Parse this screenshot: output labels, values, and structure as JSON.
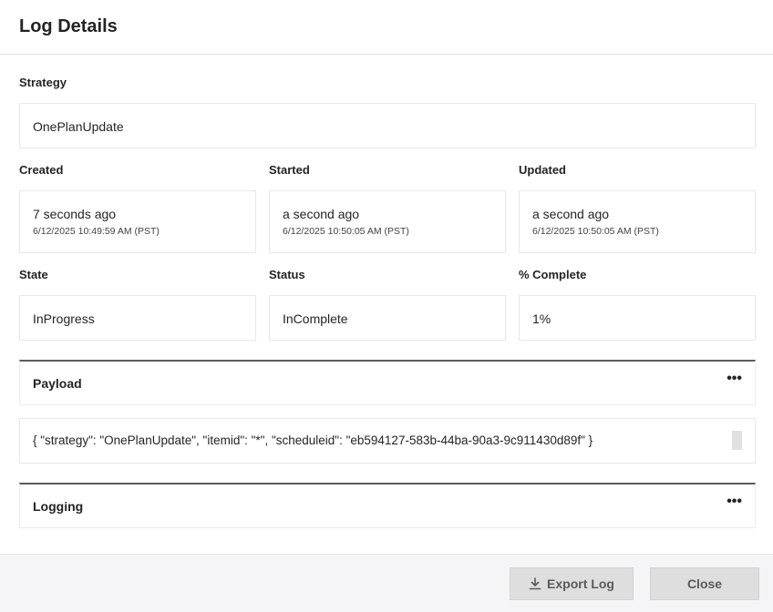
{
  "dialog": {
    "title": "Log Details"
  },
  "fields": {
    "strategy": {
      "label": "Strategy",
      "value": "OnePlanUpdate"
    },
    "created": {
      "label": "Created",
      "relative": "7 seconds ago",
      "timestamp": "6/12/2025 10:49:59 AM (PST)"
    },
    "started": {
      "label": "Started",
      "relative": "a second ago",
      "timestamp": "6/12/2025 10:50:05 AM (PST)"
    },
    "updated": {
      "label": "Updated",
      "relative": "a second ago",
      "timestamp": "6/12/2025 10:50:05 AM (PST)"
    },
    "state": {
      "label": "State",
      "value": "InProgress"
    },
    "status": {
      "label": "Status",
      "value": "InComplete"
    },
    "percent_complete": {
      "label": "% Complete",
      "value": "1%"
    }
  },
  "payload": {
    "title": "Payload",
    "menu_label": "•••",
    "content": "{ \"strategy\": \"OnePlanUpdate\", \"itemid\": \"*\", \"scheduleid\": \"eb594127-583b-44ba-90a3-9c911430d89f\" }"
  },
  "logging": {
    "title": "Logging",
    "menu_label": "•••"
  },
  "footer": {
    "export_label": "Export Log",
    "export_icon": "download-icon",
    "close_label": "Close"
  }
}
